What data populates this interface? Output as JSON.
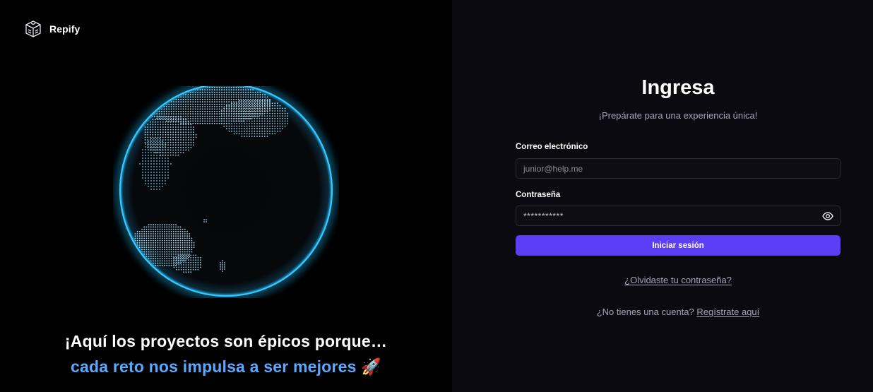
{
  "brand": {
    "name": "Repify",
    "logo_icon": "cube-logo-icon"
  },
  "hero": {
    "line1": "¡Aquí los proyectos son épicos porque…",
    "line2": "cada reto nos impulsa a ser mejores 🚀"
  },
  "login": {
    "title": "Ingresa",
    "subtitle": "¡Prepárate para una experiencia única!",
    "email_label": "Correo electrónico",
    "email_placeholder": "junior@help.me",
    "email_value": "",
    "password_label": "Contraseña",
    "password_value": "***********",
    "password_toggle_icon": "eye-icon",
    "submit_label": "Iniciar sesión",
    "forgot_link": "¿Olvidaste tu contraseña?",
    "signup_prompt": "¿No tienes una cuenta?",
    "signup_link": "Regístrate aquí"
  },
  "colors": {
    "accent": "#5b3ef5",
    "hero_highlight": "#5aa8ff",
    "globe_glow": "#21b8f0",
    "left_bg": "#000000",
    "right_bg": "#0b0a10"
  }
}
